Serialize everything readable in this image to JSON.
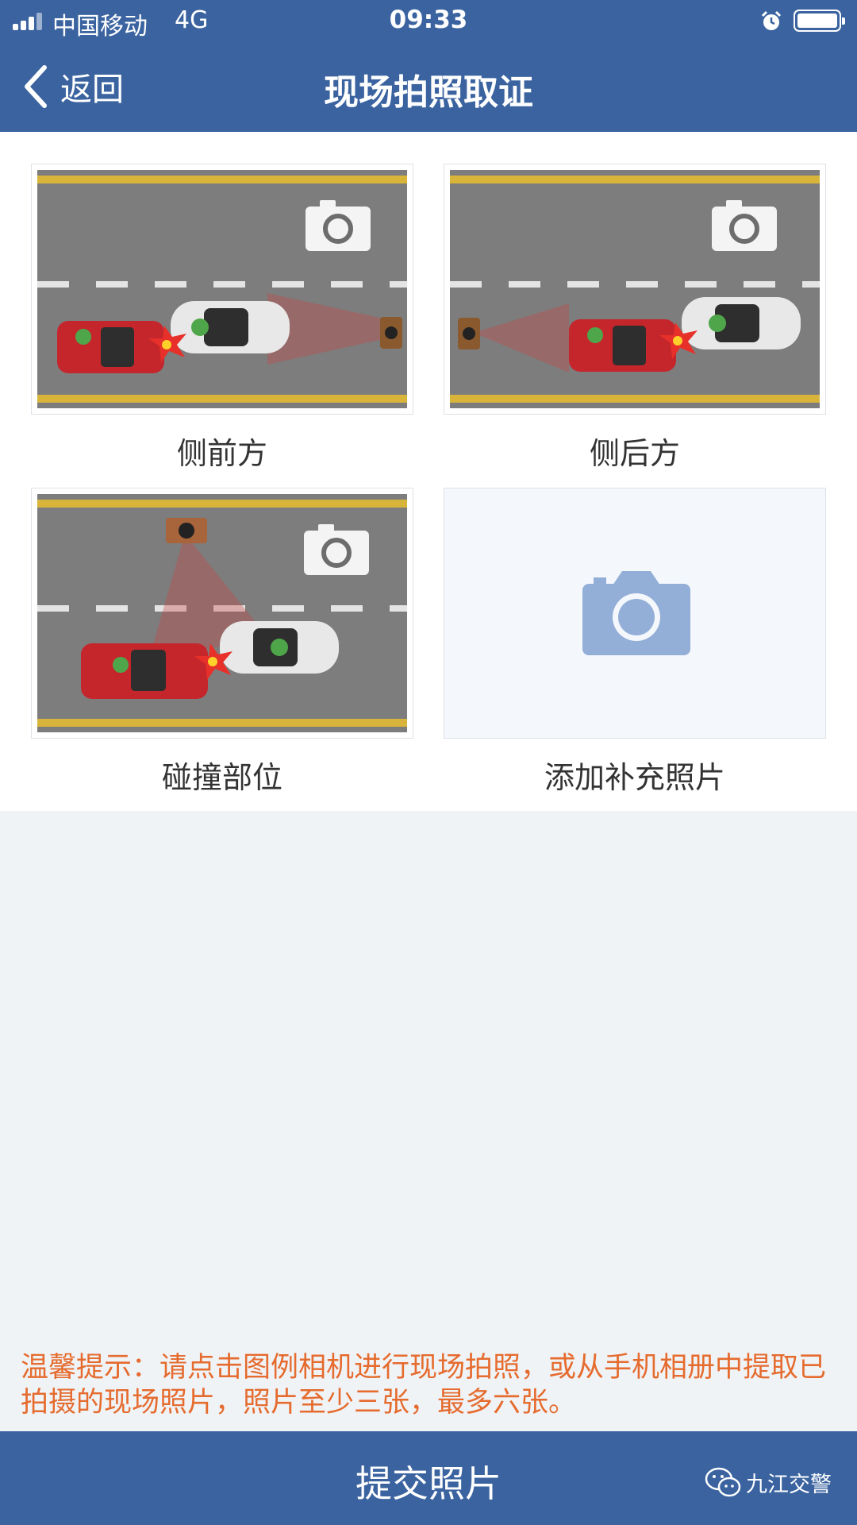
{
  "status_bar": {
    "carrier": "中国移动",
    "network": "4G",
    "time": "09:33",
    "icons": [
      "signal-icon",
      "alarm-icon",
      "battery-icon"
    ]
  },
  "nav": {
    "back_label": "返回",
    "title": "现场拍照取证"
  },
  "photos": [
    {
      "label": "侧前方",
      "icon": "camera-icon"
    },
    {
      "label": "侧后方",
      "icon": "camera-icon"
    },
    {
      "label": "碰撞部位",
      "icon": "camera-icon"
    },
    {
      "label": "添加补充照片",
      "icon": "camera-icon"
    }
  ],
  "tip": "温馨提示：请点击图例相机进行现场拍照，或从手机相册中提取已拍摄的现场照片，照片至少三张，最多六张。",
  "submit_label": "提交照片",
  "watermark": "九江交警",
  "colors": {
    "brand": "#3a63a0",
    "tip": "#e56b2e",
    "road": "#7d7d7d",
    "lane_line": "#d8b53a",
    "car_a": "#e8e8e8",
    "car_b": "#c4262b",
    "add_camera": "#93afd8"
  }
}
